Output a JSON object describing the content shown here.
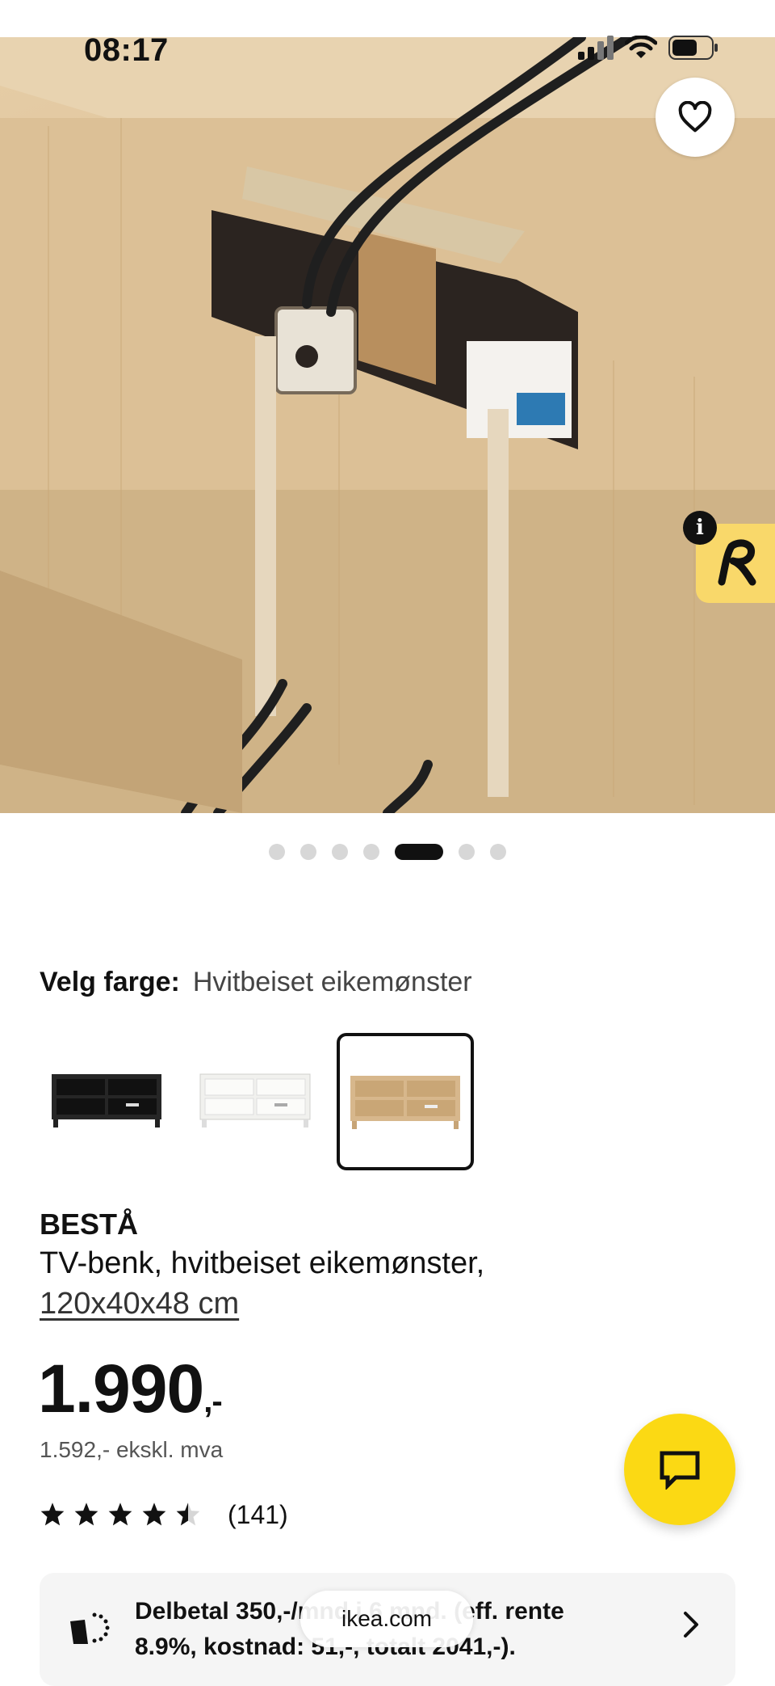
{
  "status_bar": {
    "time": "08:17"
  },
  "hero": {
    "active_index": 4,
    "total_images": 7
  },
  "color": {
    "label": "Velg farge:",
    "value": "Hvitbeiset eikemønster",
    "options": [
      {
        "name": "black-brown",
        "selected": false,
        "color": "#2b2b2b"
      },
      {
        "name": "white",
        "selected": false,
        "color": "#f3f3ef"
      },
      {
        "name": "white-stained-oak",
        "selected": true,
        "color": "#d8b58a"
      }
    ]
  },
  "product": {
    "brand": "BESTÅ",
    "description": "TV-benk, hvitbeiset eikemønster,",
    "dimensions": "120x40x48 cm",
    "price_main": "1.990",
    "price_suffix": ",-",
    "price_ex_vat": "1.592,- ekskl. mva",
    "rating": 4.5,
    "reviews": "(141)"
  },
  "finance": {
    "text": "Delbetal 350,-/mnd i 6 mnd. (eff. rente 8.9%, kostnad: 51,-, totalt 2041,-)."
  },
  "browser": {
    "url": "ikea.com"
  },
  "colors": {
    "accent": "#fbd914",
    "badge": "#f9d86a"
  }
}
